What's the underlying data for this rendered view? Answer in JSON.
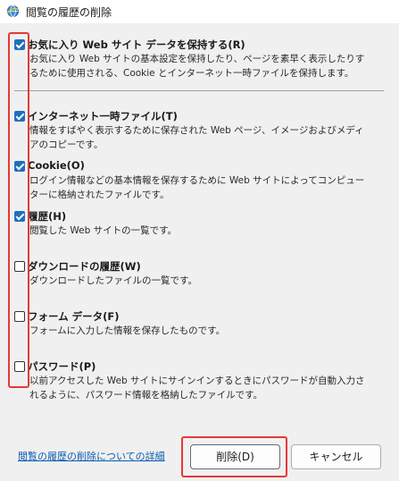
{
  "window": {
    "title": "閲覧の履歴の削除",
    "icon": "ie-globe-icon"
  },
  "options": [
    {
      "id": "favorites",
      "label": "お気に入り Web サイト データを保持する(R)",
      "checked": true,
      "desc": "お気に入り Web サイトの基本設定を保持したり、ページを素早く表示したりするために使用される、Cookie とインターネット一時ファイルを保持します。"
    },
    {
      "id": "temp-files",
      "label": "インターネット一時ファイル(T)",
      "checked": true,
      "desc": "情報をすばやく表示するために保存された Web ページ、イメージおよびメディアのコピーです。"
    },
    {
      "id": "cookies",
      "label": "Cookie(O)",
      "checked": true,
      "desc": "ログイン情報などの基本情報を保存するために Web サイトによってコンピューターに格納されたファイルです。"
    },
    {
      "id": "history",
      "label": "履歴(H)",
      "checked": true,
      "desc": "閲覧した Web サイトの一覧です。"
    },
    {
      "id": "download-history",
      "label": "ダウンロードの履歴(W)",
      "checked": false,
      "desc": "ダウンロードしたファイルの一覧です。"
    },
    {
      "id": "form-data",
      "label": "フォーム データ(F)",
      "checked": false,
      "desc": "フォームに入力した情報を保存したものです。"
    },
    {
      "id": "passwords",
      "label": "パスワード(P)",
      "checked": false,
      "desc": "以前アクセスした Web サイトにサインインするときにパスワードが自動入力されるように、パスワード情報を格納したファイルです。"
    }
  ],
  "footer": {
    "link_label": "閲覧の履歴の削除についての詳細",
    "delete_label": "削除(D)",
    "cancel_label": "キャンセル"
  },
  "colors": {
    "accent": "#1f6fbf",
    "highlight_frame": "#e53935",
    "link": "#0b5cb3"
  }
}
